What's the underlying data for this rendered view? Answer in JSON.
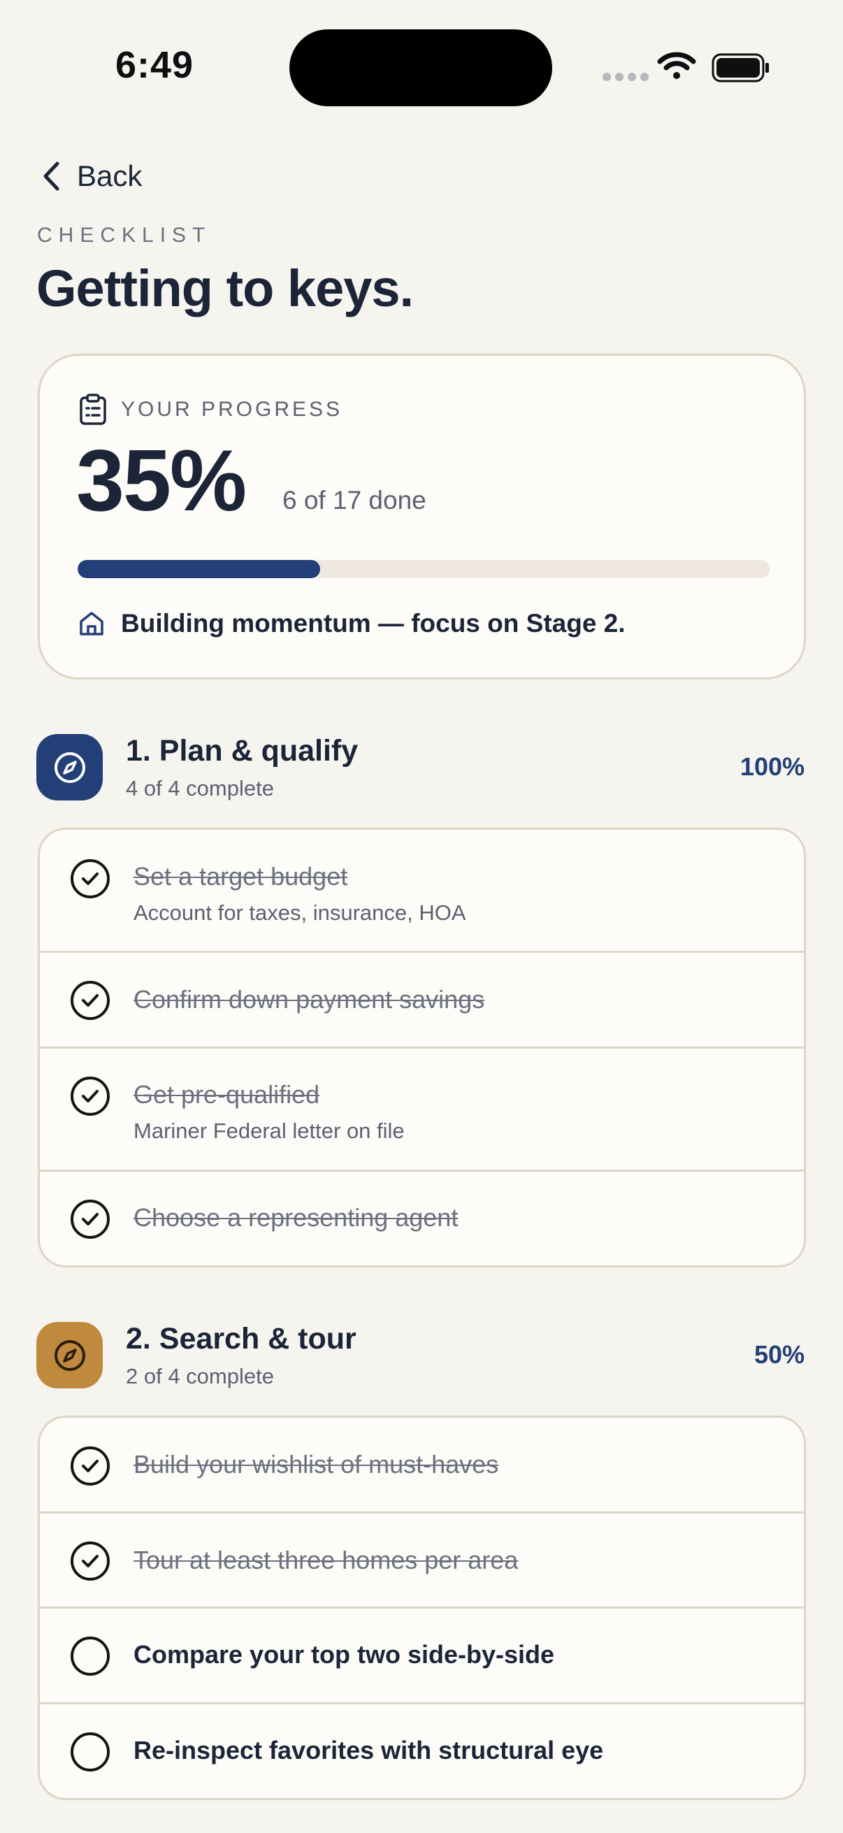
{
  "status_bar": {
    "time": "6:49"
  },
  "nav": {
    "back_label": "Back"
  },
  "header": {
    "eyebrow": "CHECKLIST",
    "title": "Getting to keys."
  },
  "progress": {
    "label": "YOUR PROGRESS",
    "percent_text": "35%",
    "percent_value": 0.35,
    "count_text": "6 of 17 done",
    "message": "Building momentum — focus on Stage 2."
  },
  "colors": {
    "accent": "#233f78",
    "stage1_badge": "#233f78",
    "stage2_badge": "#c08a3e",
    "background": "#f6f4ef"
  },
  "stages": [
    {
      "title": "1. Plan & qualify",
      "subtitle": "4 of 4 complete",
      "percent": "100%",
      "icon": "compass-icon",
      "tasks": [
        {
          "title": "Set a target budget",
          "note": "Account for taxes, insurance, HOA",
          "done": true
        },
        {
          "title": "Confirm down payment savings",
          "note": "",
          "done": true
        },
        {
          "title": "Get pre-qualified",
          "note": "Mariner Federal letter on file",
          "done": true
        },
        {
          "title": "Choose a representing agent",
          "note": "",
          "done": true
        }
      ]
    },
    {
      "title": "2. Search & tour",
      "subtitle": "2 of 4 complete",
      "percent": "50%",
      "icon": "compass-icon",
      "tasks": [
        {
          "title": "Build your wishlist of must-haves",
          "note": "",
          "done": true
        },
        {
          "title": "Tour at least three homes per area",
          "note": "",
          "done": true
        },
        {
          "title": "Compare your top two side-by-side",
          "note": "",
          "done": false
        },
        {
          "title": "Re-inspect favorites with structural eye",
          "note": "",
          "done": false
        }
      ]
    }
  ]
}
